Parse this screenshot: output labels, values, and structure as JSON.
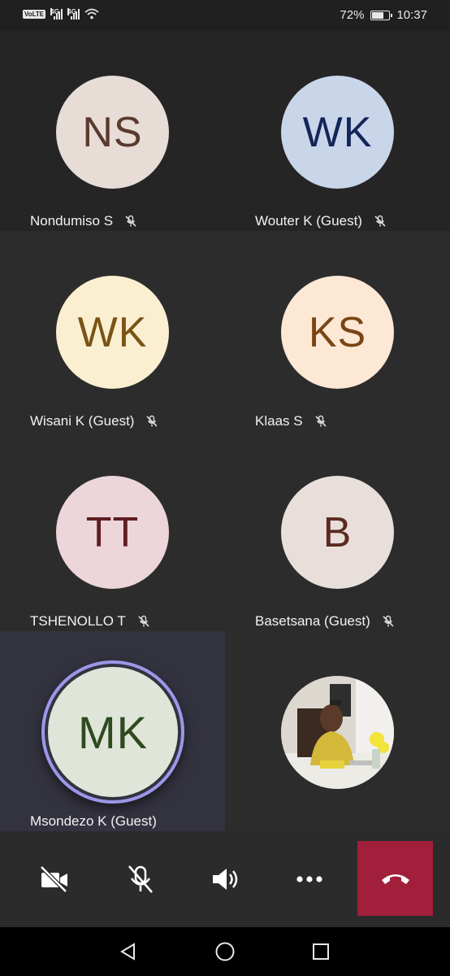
{
  "status_bar": {
    "left_indicators": [
      "VoLTE 2",
      "4G",
      "4G",
      "wifi"
    ],
    "network_1": "4G",
    "network_2": "4G",
    "battery_percent": "72%",
    "battery_level": 0.72,
    "time": "10:37"
  },
  "participants": [
    {
      "initials": "NS",
      "name": "Nondumiso S",
      "muted": true,
      "avatar_bg": "#e8dcd6",
      "avatar_fg": "#5a3a2e"
    },
    {
      "initials": "WK",
      "name": "Wouter K (Guest)",
      "muted": true,
      "avatar_bg": "#c9d6ea",
      "avatar_fg": "#14255a"
    },
    {
      "initials": "WK",
      "name": "Wisani K (Guest)",
      "muted": true,
      "avatar_bg": "#fbefd1",
      "avatar_fg": "#7a5415"
    },
    {
      "initials": "KS",
      "name": "Klaas S",
      "muted": true,
      "avatar_bg": "#fde8d5",
      "avatar_fg": "#7a4515"
    },
    {
      "initials": "TT",
      "name": "TSHENOLLO T",
      "muted": true,
      "avatar_bg": "#ecd6da",
      "avatar_fg": "#5e1e22"
    },
    {
      "initials": "B",
      "name": "Basetsana (Guest)",
      "muted": true,
      "avatar_bg": "#e9dfda",
      "avatar_fg": "#5a2a20"
    },
    {
      "initials": "MK",
      "name": "Msondezo K (Guest)",
      "muted": false,
      "speaking": true,
      "avatar_bg": "#dfe5d8",
      "avatar_fg": "#2f4a20"
    },
    {
      "name": "",
      "self_view": true,
      "photo": "self-camera-photo"
    }
  ],
  "controls": {
    "camera": "camera-off-icon",
    "mic": "mic-off-icon",
    "speaker": "speaker-icon",
    "more": "more-options-icon",
    "hangup": "hang-up-icon",
    "hangup_color": "#a11f3a"
  },
  "nav_bar": [
    "back-icon",
    "home-icon",
    "recents-icon"
  ]
}
